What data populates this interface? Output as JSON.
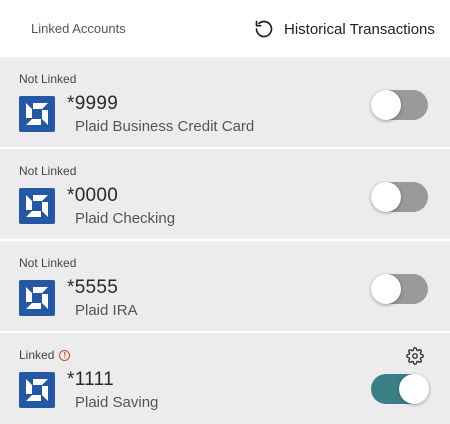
{
  "header": {
    "title": "Linked Accounts",
    "history_label": "Historical Transactions"
  },
  "accounts": [
    {
      "status": "Not Linked",
      "number": "*9999",
      "name": "Plaid Business Credit Card",
      "linked": false
    },
    {
      "status": "Not Linked",
      "number": "*0000",
      "name": "Plaid Checking",
      "linked": false
    },
    {
      "status": "Not Linked",
      "number": "*5555",
      "name": "Plaid IRA",
      "linked": false
    },
    {
      "status": "Linked",
      "number": "*1111",
      "name": "Plaid Saving",
      "linked": true
    }
  ],
  "colors": {
    "toggle_on": "#3a7f86",
    "toggle_off": "#9a9a9a",
    "bank_logo": "#2457a4",
    "warning": "#d9462f"
  },
  "icons": {
    "history": "history-icon",
    "bank_logo": "chase-logo-icon",
    "warning": "warning-icon",
    "settings": "gear-icon"
  }
}
